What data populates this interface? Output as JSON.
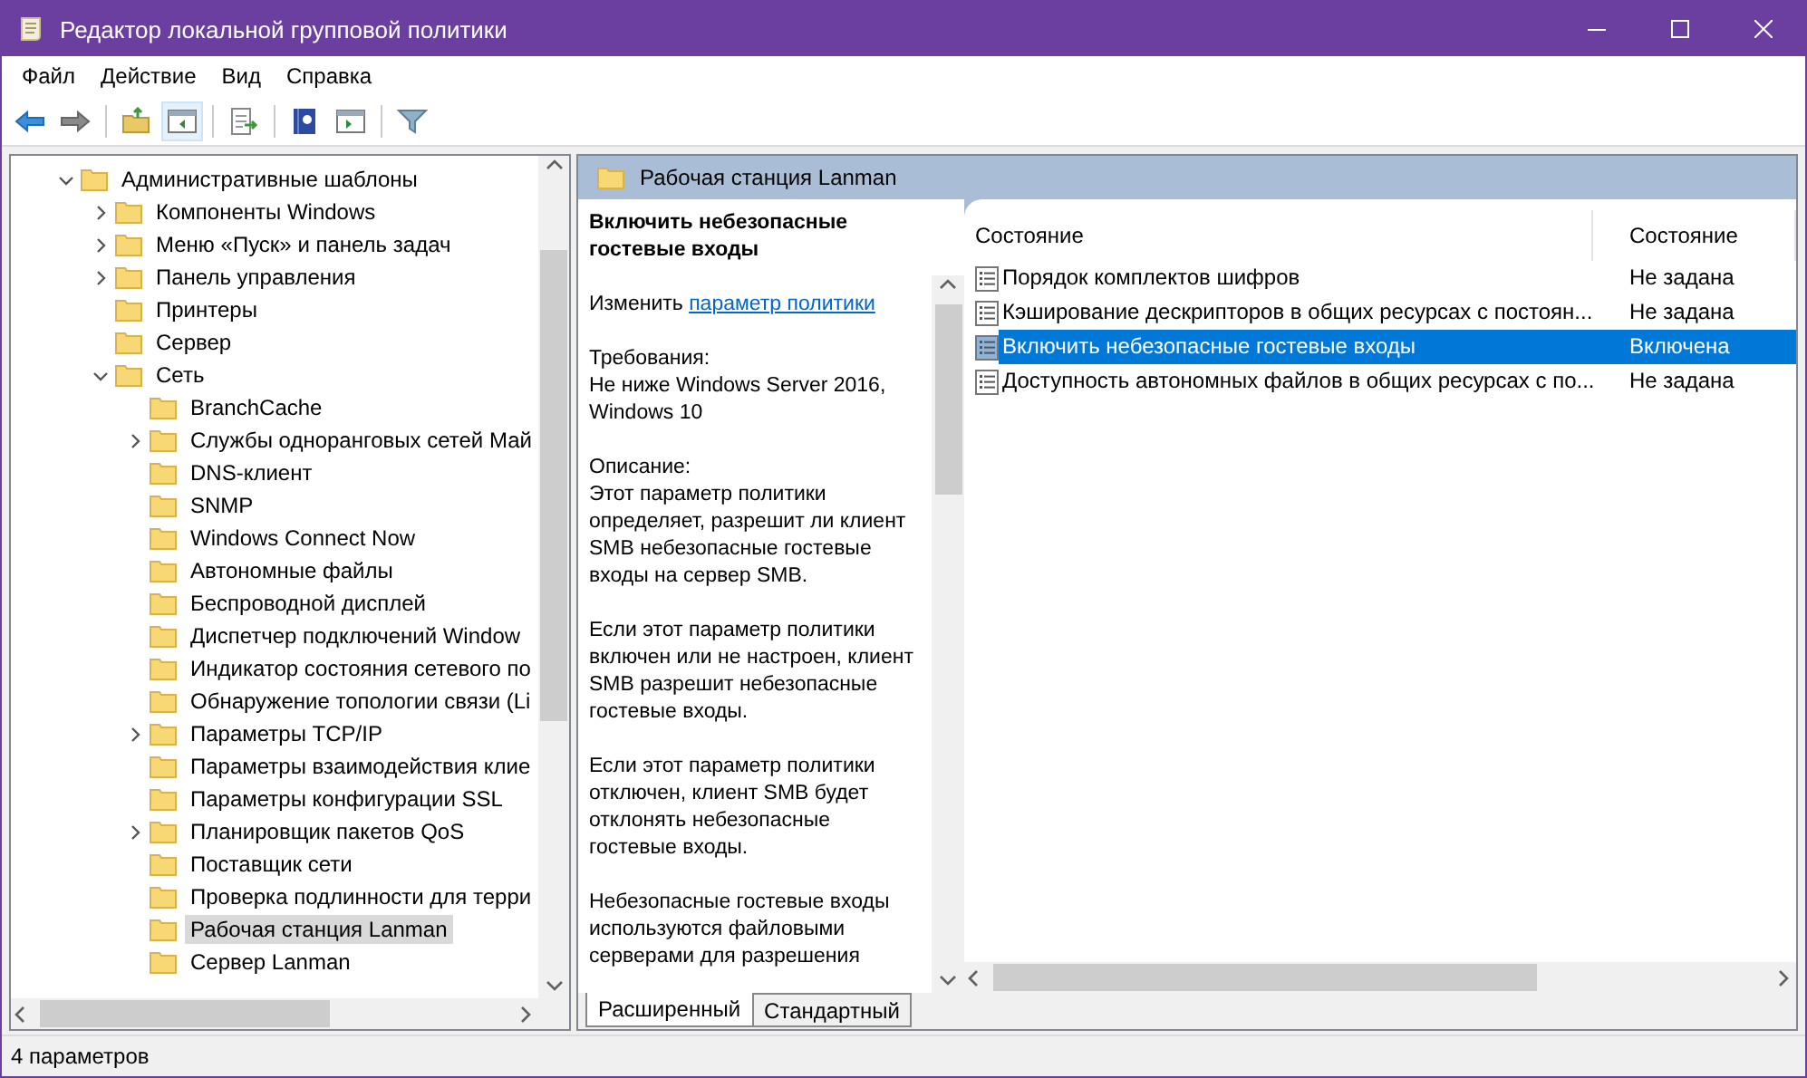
{
  "window": {
    "title": "Редактор локальной групповой политики"
  },
  "menu": [
    "Файл",
    "Действие",
    "Вид",
    "Справка"
  ],
  "tree": [
    {
      "label": "Административные шаблоны",
      "expanded": true,
      "selected": false,
      "children": [
        {
          "label": "Компоненты Windows",
          "expanded": false,
          "selected": false
        },
        {
          "label": "Меню «Пуск» и панель задач",
          "expanded": false,
          "selected": false
        },
        {
          "label": "Панель управления",
          "expanded": false,
          "selected": false
        },
        {
          "label": "Принтеры",
          "selected": false
        },
        {
          "label": "Сервер",
          "selected": false
        },
        {
          "label": "Сеть",
          "expanded": true,
          "selected": false,
          "children": [
            {
              "label": "BranchCache",
              "selected": false
            },
            {
              "label": "Службы одноранговых сетей Май",
              "expanded": false,
              "selected": false
            },
            {
              "label": "DNS-клиент",
              "selected": false
            },
            {
              "label": "SNMP",
              "selected": false
            },
            {
              "label": "Windows Connect Now",
              "selected": false
            },
            {
              "label": "Автономные файлы",
              "selected": false
            },
            {
              "label": "Беспроводной дисплей",
              "selected": false
            },
            {
              "label": "Диспетчер подключений Window",
              "selected": false
            },
            {
              "label": "Индикатор состояния сетевого по",
              "selected": false
            },
            {
              "label": "Обнаружение топологии связи (Li",
              "selected": false
            },
            {
              "label": "Параметры TCP/IP",
              "expanded": false,
              "selected": false
            },
            {
              "label": "Параметры взаимодействия клие",
              "selected": false
            },
            {
              "label": "Параметры конфигурации SSL",
              "selected": false
            },
            {
              "label": "Планировщик пакетов QoS",
              "expanded": false,
              "selected": false
            },
            {
              "label": "Поставщик сети",
              "selected": false
            },
            {
              "label": "Проверка подлинности для терри",
              "selected": false
            },
            {
              "label": "Рабочая станция Lanman",
              "selected": true
            },
            {
              "label": "Сервер Lanman",
              "selected": false
            }
          ]
        }
      ]
    }
  ],
  "header": {
    "title": "Рабочая станция Lanman"
  },
  "description": {
    "heading": "Включить небезопасные гостевые входы",
    "edit_prefix": "Изменить",
    "edit_link": "параметр политики",
    "paragraphs": [
      "Требования:\nНе ниже Windows Server 2016, Windows 10",
      "Описание:\nЭтот параметр политики определяет, разрешит ли клиент SMB небезопасные гостевые входы на сервер SMB.",
      "Если этот параметр политики включен или не настроен, клиент SMB разрешит небезопасные гостевые входы.",
      "Если этот параметр политики отключен, клиент SMB будет отклонять небезопасные гостевые входы.",
      "Небезопасные гостевые входы используются файловыми серверами для разрешения"
    ]
  },
  "columns": [
    "Состояние",
    "Состояние"
  ],
  "rows": [
    {
      "name": "Порядок комплектов шифров",
      "state": "Не задана",
      "selected": false
    },
    {
      "name": "Кэширование дескрипторов в общих ресурсах с постоян...",
      "state": "Не задана",
      "selected": false
    },
    {
      "name": "Включить небезопасные гостевые входы",
      "state": "Включена",
      "selected": true
    },
    {
      "name": "Доступность автономных файлов в общих ресурсах с по...",
      "state": "Не задана",
      "selected": false
    }
  ],
  "tabs": [
    {
      "label": "Расширенный",
      "selected": true
    },
    {
      "label": "Стандартный",
      "selected": false
    }
  ],
  "status_bar": "4 параметров"
}
